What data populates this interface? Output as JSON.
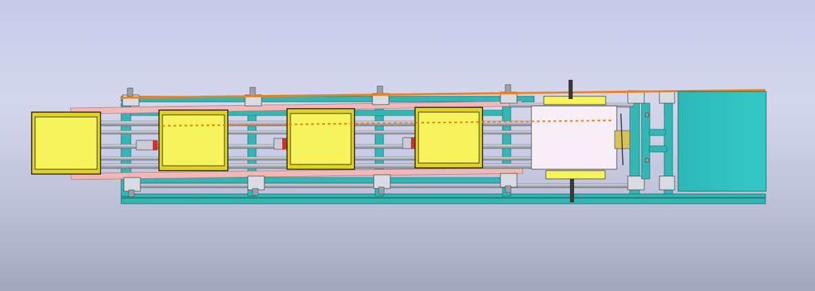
{
  "scene": {
    "description_visible_text": "",
    "colors": {
      "background_top": "#c6cae8",
      "background_bottom": "#a3a7bc",
      "frame": "#33b7b4",
      "frame_dark": "#1f8f8c",
      "rail": "#b8bcc6",
      "rail_dark": "#6a6f7a",
      "guide_pink": "#f2b8b8",
      "tray_fill": "#f7f35a",
      "tray_border": "#2a2a2a",
      "tray_outer": "#e1d21a",
      "center_line": "#f08018",
      "top_line": "#f08018",
      "box_white": "#f8eef8",
      "cabinet": "#33c3bf",
      "sensor_red": "#d23030"
    },
    "trays": [
      {
        "id": "tray-1"
      },
      {
        "id": "tray-2"
      },
      {
        "id": "tray-3"
      },
      {
        "id": "tray-4"
      }
    ]
  }
}
